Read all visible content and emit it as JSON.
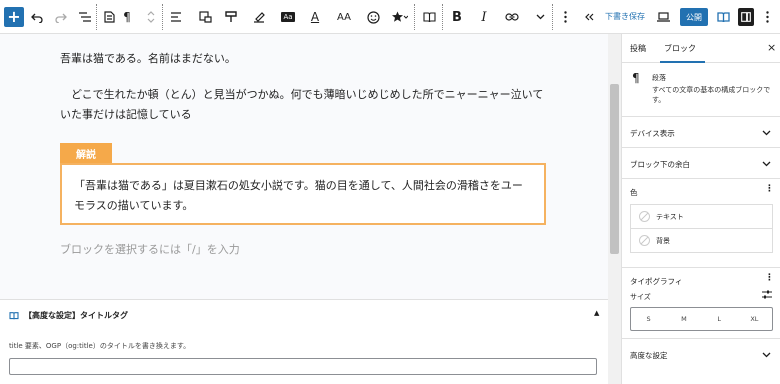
{
  "toolbar": {
    "save_draft": "下書き保存",
    "publish": "公開",
    "paragraph_icon": "¶",
    "format_aa": "Aa",
    "format_text": "A",
    "format_size": "AA",
    "bold": "B",
    "italic": "I"
  },
  "editor": {
    "paragraph_1": "吾輩は猫である。名前はまだない。",
    "paragraph_2": "　どこで生れたか頓（とん）と見当がつかぬ。何でも薄暗いじめじめした所でニャーニャー泣いていた事だけは記憶している",
    "note_label": "解説",
    "note_text": "「吾輩は猫である」は夏目漱石の処女小説です。猫の目を通して、人間社会の滑稽さをユーモラスの描いています。",
    "placeholder": "ブロックを選択するには「/」を入力"
  },
  "meta_box": {
    "title": "【高度な設定】タイトルタグ",
    "description": "title 要素、OGP（og:title）のタイトルを書き換えます。",
    "input_value": ""
  },
  "sidebar": {
    "tab_post": "投稿",
    "tab_block": "ブロック",
    "close": "×",
    "block_name": "段落",
    "block_desc": "すべての文章の基本の構成ブロックです。",
    "panel_device": "デバイス表示",
    "panel_margin": "ブロック下の余白",
    "panel_color": "色",
    "color_text": "テキスト",
    "color_bg": "背景",
    "panel_typography": "タイポグラフィ",
    "size_label": "サイズ",
    "sizes": [
      "S",
      "M",
      "L",
      "XL"
    ],
    "panel_advanced": "高度な設定"
  },
  "colors": {
    "accent": "#2271b1",
    "note_header": "#f5a94a",
    "note_border": "#f5b260"
  }
}
